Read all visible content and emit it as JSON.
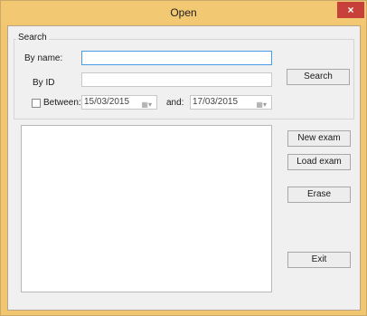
{
  "window": {
    "title": "Open",
    "close_glyph": "×"
  },
  "search": {
    "group_label": "Search",
    "by_name_label": "By name:",
    "by_name_value": "",
    "by_id_label": "By ID",
    "by_id_value": "",
    "between_label": "Between:",
    "between_checked": false,
    "date_from": "15/03/2015",
    "and_label": "and:",
    "date_to": "17/03/2015",
    "calendar_glyph": "▦▾",
    "search_button": "Search"
  },
  "actions": {
    "new_exam": "New exam",
    "load_exam": "Load exam",
    "erase": "Erase",
    "exit": "Exit"
  },
  "results": {
    "items": []
  },
  "colors": {
    "titlebar": "#f3c873",
    "close": "#c7413a",
    "focus_border": "#4a9be8"
  }
}
